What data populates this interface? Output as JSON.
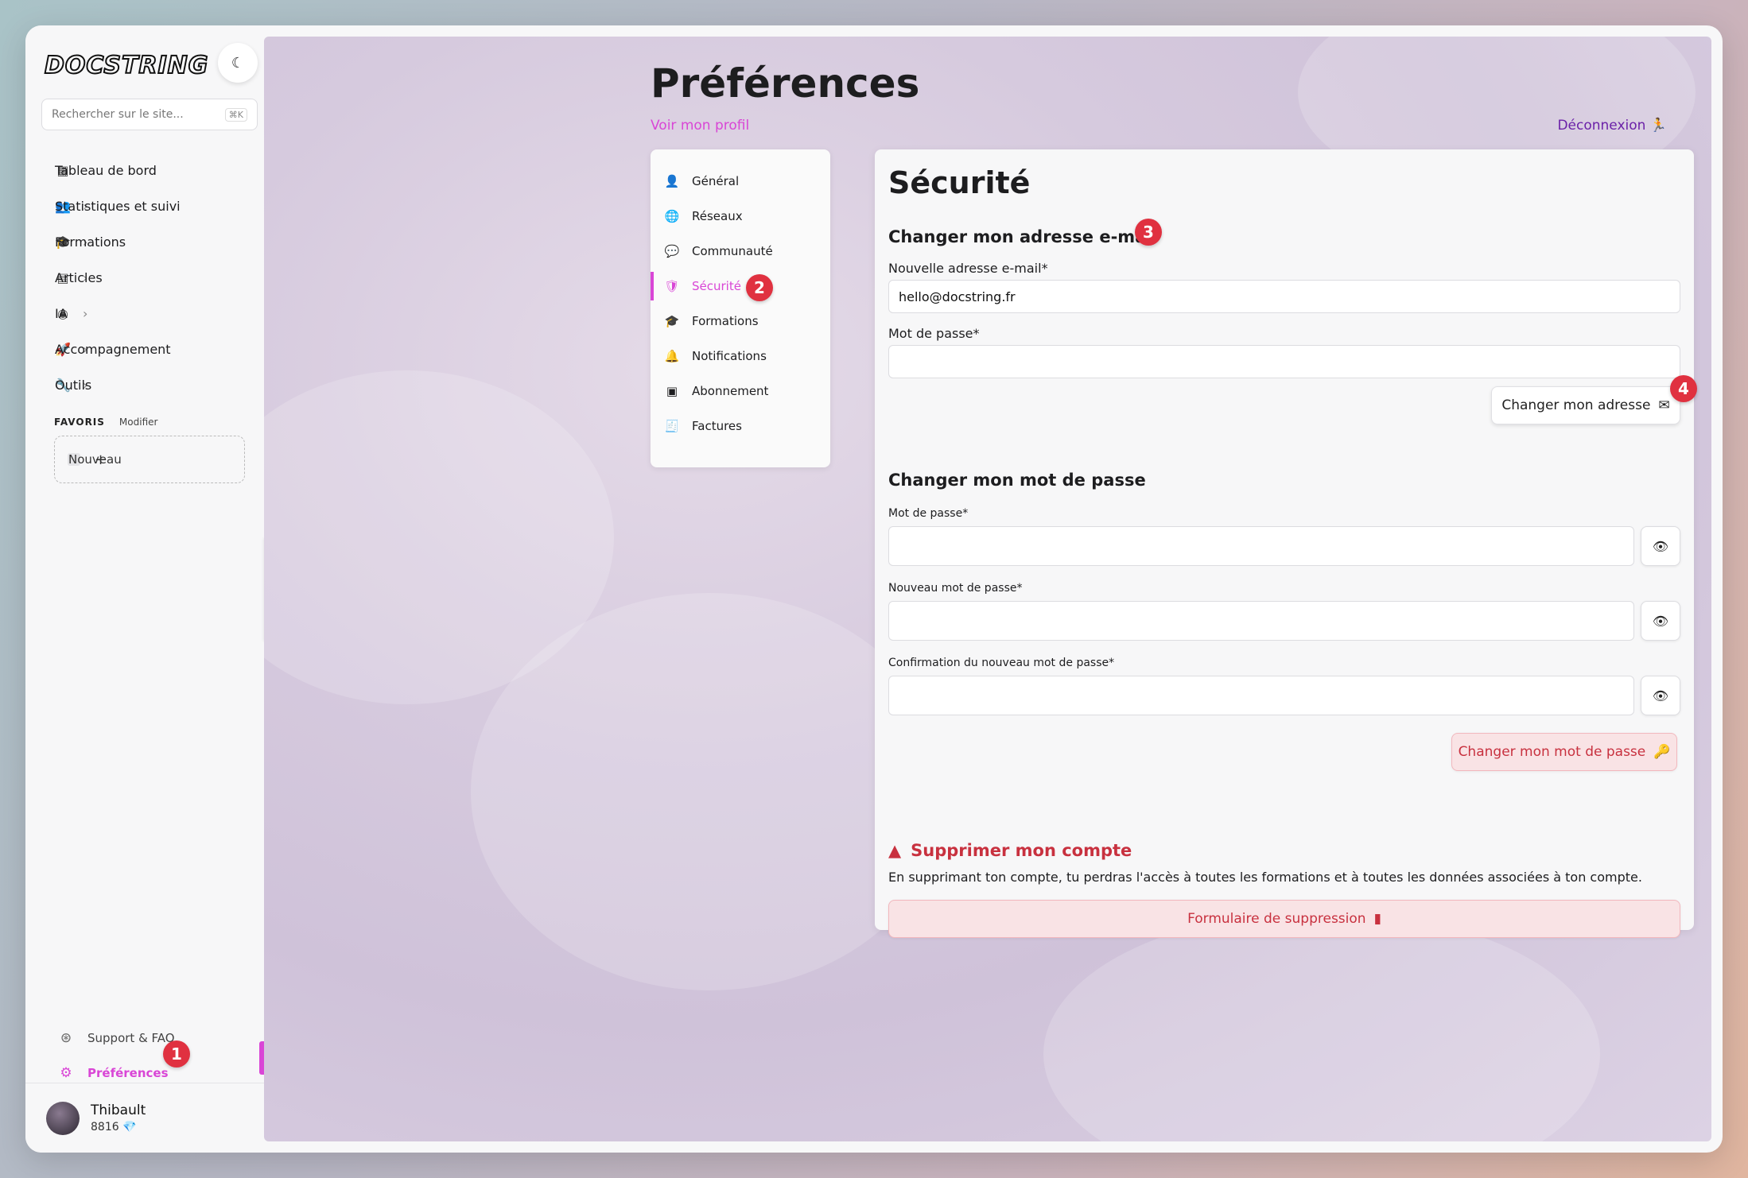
{
  "sidebar": {
    "logo": "DOCSTRING",
    "theme_icon": "moon-icon",
    "search": {
      "placeholder": "Rechercher sur le site...",
      "shortcut": "⌘K"
    },
    "items": [
      {
        "label": "Tableau de bord",
        "icon": "dashboard-icon",
        "has_children": false
      },
      {
        "label": "Statistiques et suivi",
        "icon": "users-icon",
        "has_children": true
      },
      {
        "label": "Formations",
        "icon": "graduation-cap-icon",
        "has_children": true
      },
      {
        "label": "Articles",
        "icon": "file-icon",
        "has_children": true
      },
      {
        "label": "IA",
        "icon": "brain-icon",
        "has_children": true
      },
      {
        "label": "Accompagnement",
        "icon": "rocket-icon",
        "has_children": true
      },
      {
        "label": "Outils",
        "icon": "wrench-icon",
        "has_children": true
      }
    ],
    "favorites": {
      "title": "FAVORIS",
      "edit": "Modifier",
      "new_label": "Nouveau"
    },
    "bottom": [
      {
        "label": "Support & FAQ",
        "icon": "lifebuoy-icon"
      },
      {
        "label": "Préférences",
        "icon": "gear-icon",
        "active": true
      }
    ],
    "user": {
      "name": "Thibault",
      "points": "8816",
      "gem": "💎"
    }
  },
  "header": {
    "title": "Préférences",
    "profile_link": "Voir mon profil",
    "logout": "Déconnexion"
  },
  "menu": [
    {
      "label": "Général",
      "icon": "user-icon"
    },
    {
      "label": "Réseaux",
      "icon": "globe-icon"
    },
    {
      "label": "Communauté",
      "icon": "chat-icon"
    },
    {
      "label": "Sécurité",
      "icon": "shield-icon",
      "active": true
    },
    {
      "label": "Formations",
      "icon": "graduation-cap-icon"
    },
    {
      "label": "Notifications",
      "icon": "bell-icon"
    },
    {
      "label": "Abonnement",
      "icon": "subscription-icon"
    },
    {
      "label": "Factures",
      "icon": "invoice-icon"
    }
  ],
  "security": {
    "title": "Sécurité",
    "email_section": {
      "heading": "Changer mon adresse e-mail",
      "new_email_label": "Nouvelle adresse e-mail*",
      "new_email_value": "hello@docstring.fr",
      "password_label": "Mot de passe*",
      "password_value": "",
      "submit": "Changer mon adresse"
    },
    "password_section": {
      "heading": "Changer mon mot de passe",
      "current_label": "Mot de passe*",
      "new_label": "Nouveau mot de passe*",
      "confirm_label": "Confirmation du nouveau mot de passe*",
      "submit": "Changer mon mot de passe"
    },
    "delete_section": {
      "heading": "Supprimer mon compte",
      "description": "En supprimant ton compte, tu perdras l'accès à toutes les formations et à toutes les données associées à ton compte.",
      "button": "Formulaire de suppression"
    }
  },
  "badges": [
    "1",
    "2",
    "3",
    "4"
  ],
  "colors": {
    "accent": "#d946d6",
    "danger": "#c8313f",
    "badge": "#e03140",
    "logout": "#6b21a8"
  }
}
